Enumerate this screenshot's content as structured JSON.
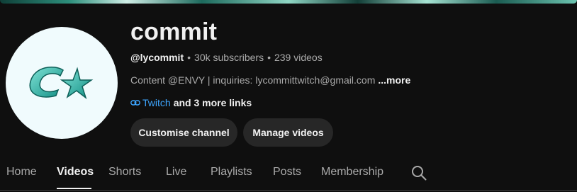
{
  "channel": {
    "name": "commit",
    "handle": "@lycommit",
    "subscribers": "30k subscribers",
    "videos": "239 videos",
    "description": "Content @ENVY | inquiries: lycommittwitch@gmail.com",
    "more_label": "...more",
    "link_label": "Twitch",
    "more_links_label": "and 3 more links",
    "avatar_icon": "ck-logo-icon"
  },
  "buttons": {
    "customise": "Customise channel",
    "manage": "Manage videos"
  },
  "tabs": [
    {
      "label": "Home"
    },
    {
      "label": "Videos",
      "active": true
    },
    {
      "label": "Shorts"
    },
    {
      "label": "Live"
    },
    {
      "label": "Playlists"
    },
    {
      "label": "Posts"
    },
    {
      "label": "Membership"
    }
  ],
  "colors": {
    "background": "#0f0f0f",
    "button": "#272727",
    "link": "#3ea6ff",
    "avatar_bg": "#f0fbfd",
    "logo_teal": "#2bbfb0"
  }
}
